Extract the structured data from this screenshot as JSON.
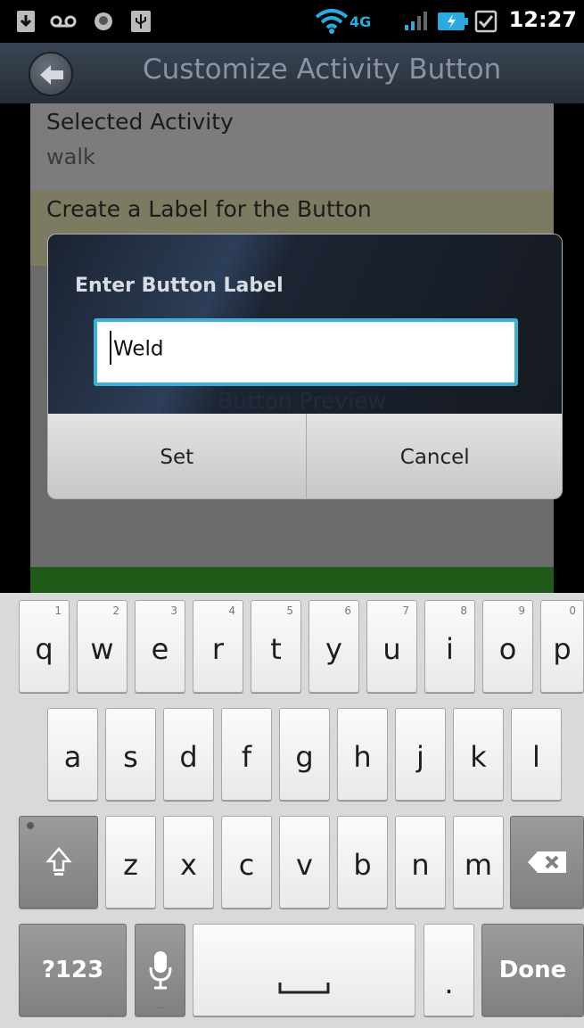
{
  "status_bar": {
    "time": "12:27",
    "icons": [
      "download-icon",
      "voicemail-icon",
      "notification-icon",
      "usb-icon",
      "wifi-icon",
      "4g-lte-icon",
      "signal-icon",
      "battery-icon",
      "checkbox-icon"
    ],
    "network": "4G"
  },
  "app_bar": {
    "title": "Customize Activity Button",
    "back_icon": "arrow-left-icon"
  },
  "content": {
    "selected_activity_title": "Selected Activity",
    "selected_activity_value": "walk",
    "label_row_text": "Create a Label for the Button",
    "behind_text": "Button Preview"
  },
  "dialog": {
    "title": "Enter Button Label",
    "input_value": "Weld",
    "set_label": "Set",
    "cancel_label": "Cancel"
  },
  "keyboard": {
    "row1": [
      {
        "ch": "q",
        "hint": "1"
      },
      {
        "ch": "w",
        "hint": "2"
      },
      {
        "ch": "e",
        "hint": "3"
      },
      {
        "ch": "r",
        "hint": "4"
      },
      {
        "ch": "t",
        "hint": "5"
      },
      {
        "ch": "y",
        "hint": "6"
      },
      {
        "ch": "u",
        "hint": "7"
      },
      {
        "ch": "i",
        "hint": "8"
      },
      {
        "ch": "o",
        "hint": "9"
      },
      {
        "ch": "p",
        "hint": "0"
      }
    ],
    "row2": [
      "a",
      "s",
      "d",
      "f",
      "g",
      "h",
      "j",
      "k",
      "l"
    ],
    "row3": [
      "z",
      "x",
      "c",
      "v",
      "b",
      "n",
      "m"
    ],
    "symbols_label": "?123",
    "period": ".",
    "done_label": "Done"
  }
}
